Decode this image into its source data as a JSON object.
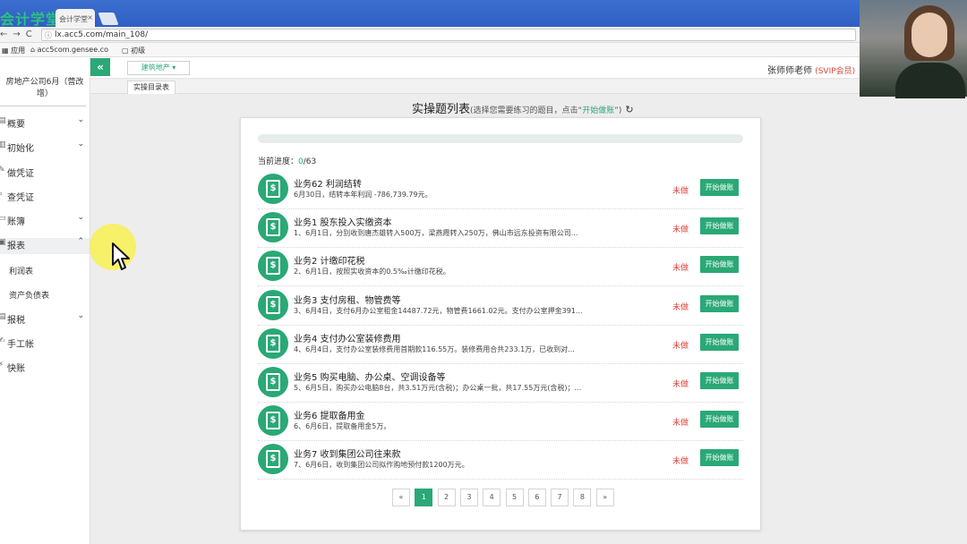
{
  "browser": {
    "logo_text": "会计学堂",
    "tab_label": "会计学堂",
    "tab_close": "×",
    "url": "lx.acc5.com/main_108/",
    "bookmarks": [
      "应用",
      "acc5com.gensee.co",
      "初级"
    ]
  },
  "header": {
    "dept_select": "建筑地产 ▾",
    "teacher_name": "张师师老师",
    "vip_label": "(SVIP会员)",
    "page_tab": "实操目录表"
  },
  "sidebar": {
    "company": "房地产公司6月（营改增）",
    "items": [
      {
        "label": "概要",
        "icon": "grid-icon",
        "chev": "⌄"
      },
      {
        "label": "初始化",
        "icon": "gear-icon",
        "chev": "⌄"
      },
      {
        "label": "做凭证",
        "icon": "pen-icon",
        "chev": ""
      },
      {
        "label": "查凭证",
        "icon": "search-icon",
        "chev": ""
      },
      {
        "label": "账簿",
        "icon": "book-icon",
        "chev": "⌄"
      },
      {
        "label": "报表",
        "icon": "report-icon",
        "chev": "⌃"
      },
      {
        "label": "报税",
        "icon": "tax-icon",
        "chev": "⌄"
      },
      {
        "label": "手工帐",
        "icon": "hand-icon",
        "chev": ""
      },
      {
        "label": "快账",
        "icon": "quick-icon",
        "chev": ""
      }
    ],
    "sub_items": [
      "利润表",
      "资产负债表"
    ]
  },
  "panel": {
    "title": "实操题列表",
    "hint_prefix": "(选择您需要练习的题目，点击“",
    "hint_action": "开始做账",
    "hint_suffix": "”)",
    "refresh_icon": "↻",
    "progress_label": "当前进度：",
    "progress_done": "0",
    "progress_total": "/63",
    "progress_fraction": 0
  },
  "tasks": [
    {
      "title": "业务62 利润结转",
      "desc": "6月30日，结转本年利润 -786,739.79元。",
      "status": "未做",
      "button": "开始做账"
    },
    {
      "title": "业务1 股东投入实缴资本",
      "desc": "1、6月1日，分别收到唐杰雄转入500万，梁燕霞转入250万，佛山市远东投资有限公司...",
      "status": "未做",
      "button": "开始做账"
    },
    {
      "title": "业务2 计缴印花税",
      "desc": "2、6月1日，按照实收资本的0.5‰计缴印花税。",
      "status": "未做",
      "button": "开始做账"
    },
    {
      "title": "业务3 支付房租、物管费等",
      "desc": "3、6月4日，支付6月办公室租金14487.72元，物管费1661.02元。支付办公室押金391...",
      "status": "未做",
      "button": "开始做账"
    },
    {
      "title": "业务4 支付办公室装修费用",
      "desc": "4、6月4日，支付办公室装修费用首期款116.55万。装修费用合共233.1万，已收到对...",
      "status": "未做",
      "button": "开始做账"
    },
    {
      "title": "业务5 购买电脑、办公桌、空调设备等",
      "desc": "5、6月5日，购买办公电脑8台，共3.51万元(含税)；办公桌一批，共17.55万元(含税)；...",
      "status": "未做",
      "button": "开始做账"
    },
    {
      "title": "业务6 提取备用金",
      "desc": "6、6月6日，提取备用金5万。",
      "status": "未做",
      "button": "开始做账"
    },
    {
      "title": "业务7 收到集团公司往来款",
      "desc": "7、6月6日，收到集团公司拟作购地预付款1200万元。",
      "status": "未做",
      "button": "开始做账"
    }
  ],
  "pager": [
    "«",
    "1",
    "2",
    "3",
    "4",
    "5",
    "6",
    "7",
    "8",
    "»"
  ],
  "pager_active": "1",
  "colors": {
    "accent": "#2aa876",
    "status_red": "#d9463e"
  }
}
